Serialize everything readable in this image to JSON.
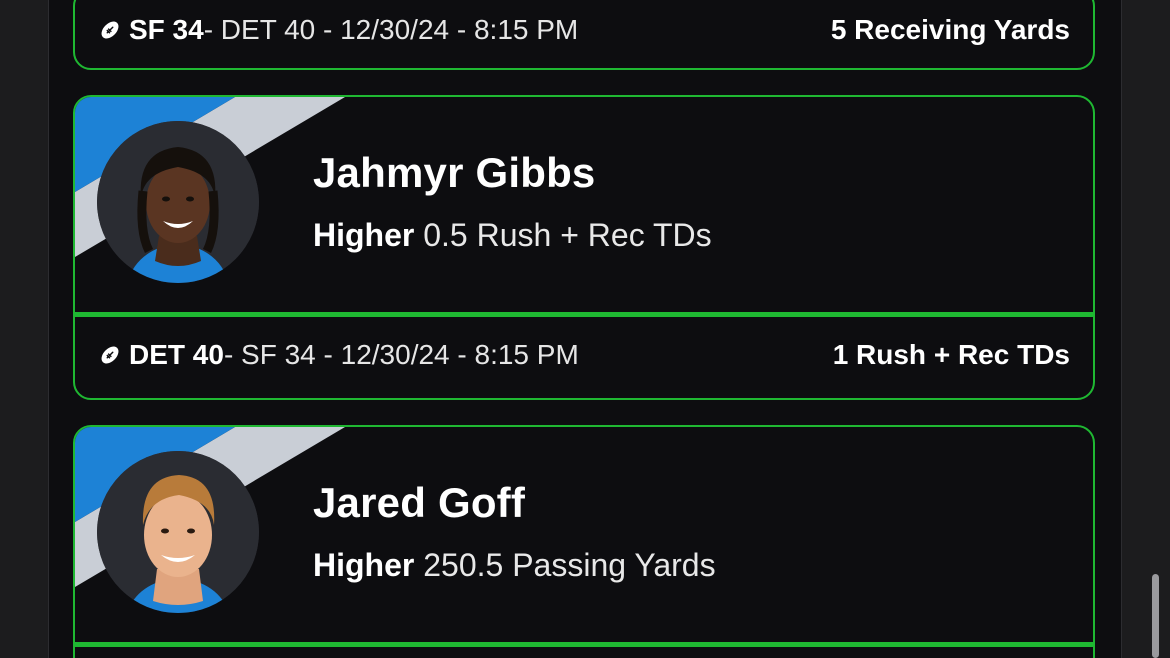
{
  "cards": [
    {
      "footer": {
        "team": "SF 34",
        "rest": " - DET 40 - 12/30/24 - 8:15 PM",
        "result": "5 Receiving Yards"
      }
    },
    {
      "player_name": "Jahmyr Gibbs",
      "pick_direction": "Higher",
      "pick_stat": " 0.5 Rush + Rec TDs",
      "footer": {
        "team": "DET 40",
        "rest": " - SF 34 - 12/30/24 - 8:15 PM",
        "result": "1 Rush + Rec TDs"
      }
    },
    {
      "player_name": "Jared Goff",
      "pick_direction": "Higher",
      "pick_stat": " 250.5 Passing Yards"
    }
  ],
  "icons": {
    "football": "football-icon",
    "avatar": "player-headshot"
  },
  "colors": {
    "accent_green": "#1fb832",
    "team_blue": "#1d82d6",
    "team_silver": "#c9ced6",
    "card_bg": "#0d0d10"
  }
}
